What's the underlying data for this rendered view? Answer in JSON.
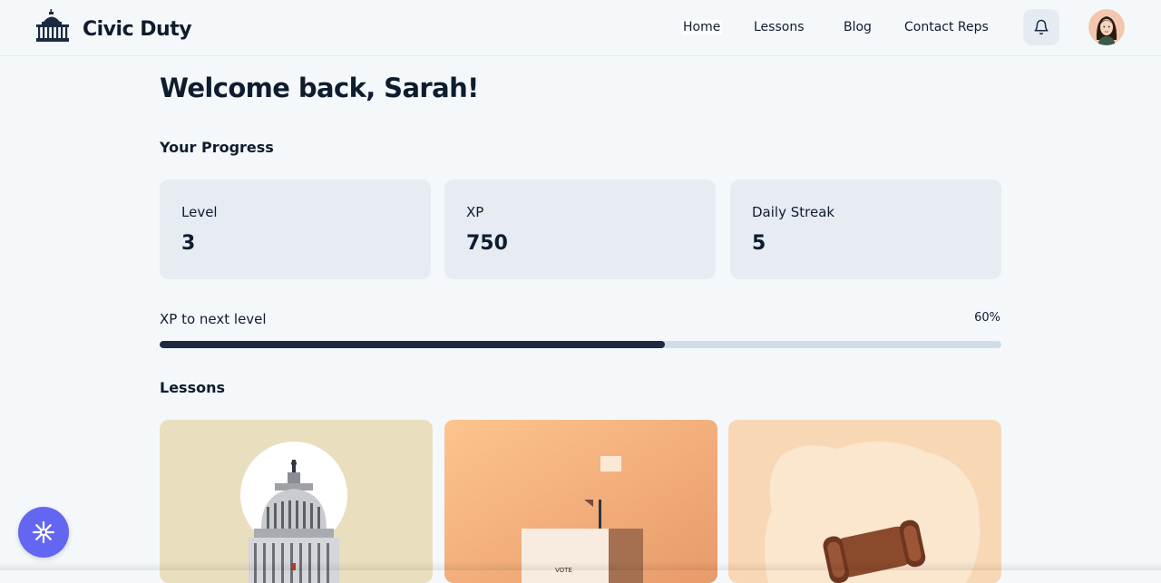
{
  "brand": {
    "name": "Civic Duty",
    "logo_icon": "capitol-building-icon"
  },
  "nav": {
    "items": [
      {
        "label": "Home",
        "active": true
      },
      {
        "label": "Lessons",
        "active": false
      },
      {
        "label": "Blog",
        "active": false
      },
      {
        "label": "Contact Reps",
        "active": false
      }
    ],
    "notification_icon": "bell-icon",
    "avatar": "user-avatar"
  },
  "welcome": {
    "title": "Welcome back, Sarah!"
  },
  "progress": {
    "title": "Your Progress",
    "stats": [
      {
        "label": "Level",
        "value": "3"
      },
      {
        "label": "XP",
        "value": "750"
      },
      {
        "label": "Daily Streak",
        "value": "5"
      }
    ],
    "xp_label": "XP to next level",
    "xp_percent_text": "60%",
    "xp_fraction": 0.6
  },
  "lessons": {
    "title": "Lessons",
    "cards": [
      {
        "image": "capitol-dome-image"
      },
      {
        "image": "ballot-box-image",
        "image_text": "VOTE"
      },
      {
        "image": "gavel-image"
      }
    ]
  },
  "fab": {
    "icon": "sparkle-icon"
  },
  "colors": {
    "background": "#f4f8fb",
    "card": "#e7ecf3",
    "text": "#0f1c2e",
    "progress_fill": "#1b2a40",
    "progress_track": "#cfdde7",
    "fab": "#6366f1"
  }
}
